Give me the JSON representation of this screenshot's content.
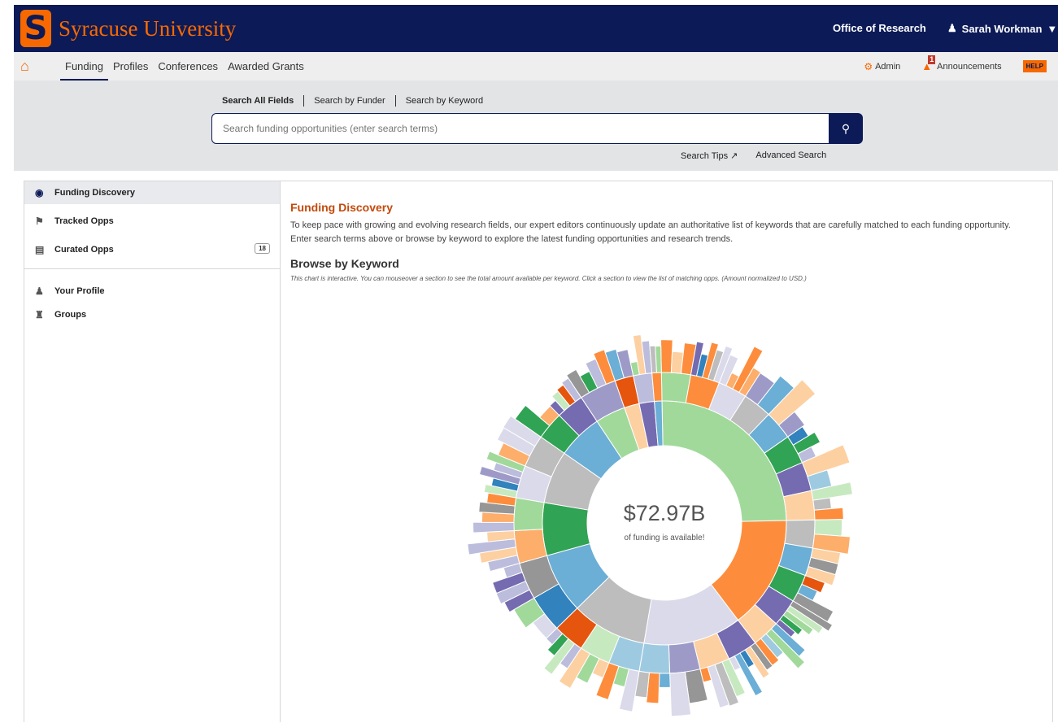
{
  "header": {
    "logo_letter": "S",
    "brand": "Syracuse University",
    "office": "Office of Research",
    "user": "Sarah Workman"
  },
  "nav": {
    "links": [
      "Funding",
      "Profiles",
      "Conferences",
      "Awarded Grants"
    ],
    "admin": "Admin",
    "announcements": "Announcements",
    "announcement_count": "1",
    "help": "HELP"
  },
  "search": {
    "tabs": [
      "Search All Fields",
      "Search by Funder",
      "Search by Keyword"
    ],
    "placeholder": "Search funding opportunities (enter search terms)",
    "tips": "Search Tips",
    "advanced": "Advanced Search"
  },
  "sidebar": {
    "items": [
      {
        "label": "Funding Discovery",
        "icon": "compass-icon"
      },
      {
        "label": "Tracked Opps",
        "icon": "flag-icon"
      },
      {
        "label": "Curated Opps",
        "icon": "copy-icon",
        "count": "18"
      },
      {
        "label": "Your Profile",
        "icon": "user-icon"
      },
      {
        "label": "Groups",
        "icon": "bank-icon"
      }
    ]
  },
  "main": {
    "title": "Funding Discovery",
    "description": "To keep pace with growing and evolving research fields, our expert editors continuously update an authoritative list of keywords that are carefully matched to each funding opportunity. Enter search terms above or browse by keyword to explore the latest funding opportunities and research trends.",
    "browse_title": "Browse by Keyword",
    "browse_note": "This chart is interactive. You can mouseover a section to see the total amount available per keyword. Click a section to view the list of matching opps. (Amount normalized to USD.)",
    "total": "$72.97B",
    "total_caption": "of funding is available!"
  },
  "chart_data": {
    "type": "sunburst",
    "center_label": "$72.97B",
    "center_caption": "of funding is available!",
    "inner_ring_fractions": [
      0.25,
      0.15,
      0.13,
      0.1,
      0.08,
      0.07,
      0.07,
      0.06,
      0.04,
      0.02,
      0.02,
      0.01
    ],
    "colors": {
      "green": "#a1d99b",
      "orange": "#fd8d3c",
      "lavender": "#dadaeb",
      "gray": "#bdbdbd",
      "blue": "#6baed6",
      "dark_green": "#31a354",
      "purple": "#756bb1",
      "peach": "#fdd0a2"
    }
  }
}
